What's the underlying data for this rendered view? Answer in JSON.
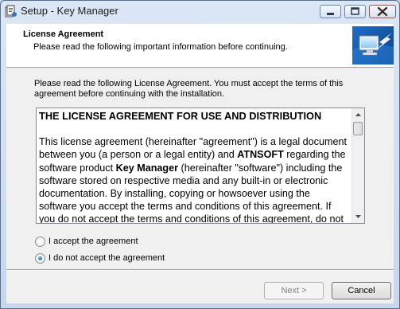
{
  "window": {
    "title": "Setup - Key Manager"
  },
  "header": {
    "title": "License Agreement",
    "subtitle": "Please read the following important information before continuing."
  },
  "instructions": "Please read the following License Agreement. You must accept the terms of this agreement before continuing with the installation.",
  "license": {
    "heading": "THE LICENSE AGREEMENT FOR USE AND DISTRIBUTION",
    "p1": "This license agreement (hereinafter \"agreement\") is a legal document between you (a person or a legal entity) and ",
    "company": "ATNSOFT",
    "p2": " regarding the software product ",
    "product": "Key Manager",
    "p3": " (hereinafter \"software\") including the software stored on respective media and any built-in or electronic documentation. By installing, copying or howsoever using the software you accept the terms and conditions of this agreement. If you do not accept the terms and conditions of this agreement, do not install or use the software."
  },
  "options": {
    "accept": {
      "label": "I accept the agreement",
      "checked": false
    },
    "decline": {
      "label": "I do not accept the agreement",
      "checked": true
    }
  },
  "buttons": {
    "next": "Next >",
    "cancel": "Cancel",
    "next_enabled": false
  },
  "icons": {
    "app": "setup-app-icon",
    "header": "computer-setup-icon"
  },
  "colors": {
    "titlebar": "#c6d7ee",
    "client": "#f0f0f0",
    "accent_radio": "#1c5da0"
  }
}
